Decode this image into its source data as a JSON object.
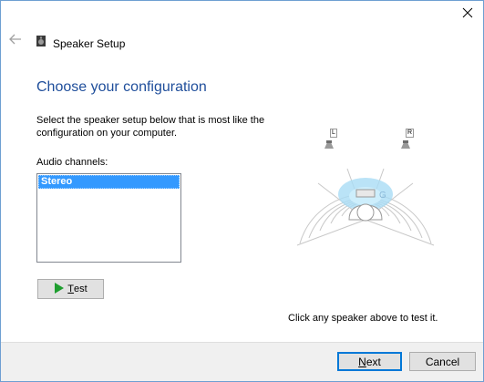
{
  "window": {
    "title": "Speaker Setup",
    "close_glyph": "✕",
    "back_glyph": "←"
  },
  "content": {
    "heading": "Choose your configuration",
    "description": "Select the speaker setup below that is most like the configuration on your computer.",
    "channels_label": "Audio channels:",
    "channels": [
      "Stereo"
    ],
    "selected_channel": "Stereo",
    "test_button": {
      "prefix": "",
      "accel": "T",
      "rest": "est"
    },
    "hint": "Click any speaker above to test it."
  },
  "diagram": {
    "left_speaker": "L",
    "right_speaker": "R",
    "listener_letter": "G"
  },
  "footer": {
    "next": {
      "accel": "N",
      "rest": "ext"
    },
    "cancel": "Cancel"
  },
  "colors": {
    "heading": "#1f4e9b",
    "selection": "#3399ff",
    "accent_border": "#0078d7",
    "test_triangle": "#1e9e2f"
  }
}
